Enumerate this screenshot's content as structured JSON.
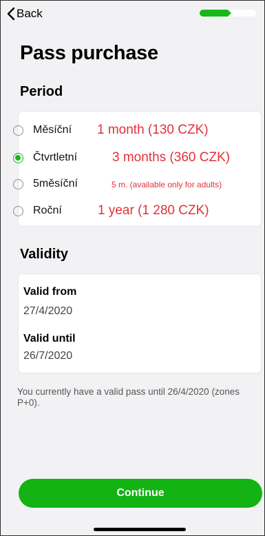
{
  "nav": {
    "back_label": "Back",
    "steps_total": 4,
    "current_step": 2
  },
  "page": {
    "title": "Pass purchase"
  },
  "period": {
    "title": "Period",
    "options": [
      {
        "name": "Měsíční",
        "note": "1 month (130 CZK)",
        "selected": false
      },
      {
        "name": "Čtvrtletní",
        "note": "3 months (360 CZK)",
        "selected": true
      },
      {
        "name": "5měsíční",
        "note": "5 m. (available only for adults)",
        "selected": false
      },
      {
        "name": "Roční",
        "note": "1 year (1 280 CZK)",
        "selected": false
      }
    ]
  },
  "validity": {
    "title": "Validity",
    "from_label": "Valid from",
    "from_value": "27/4/2020",
    "until_label": "Valid until",
    "until_value": "26/7/2020"
  },
  "info": {
    "text": "You currently have a valid pass until 26/4/2020 (zones P+0)."
  },
  "footer": {
    "continue_label": "Continue"
  },
  "colors": {
    "accent": "#16b81a",
    "annotation": "#e0313a",
    "background": "#f2f2f4"
  },
  "icons": {
    "back": "chevron-left-icon"
  }
}
